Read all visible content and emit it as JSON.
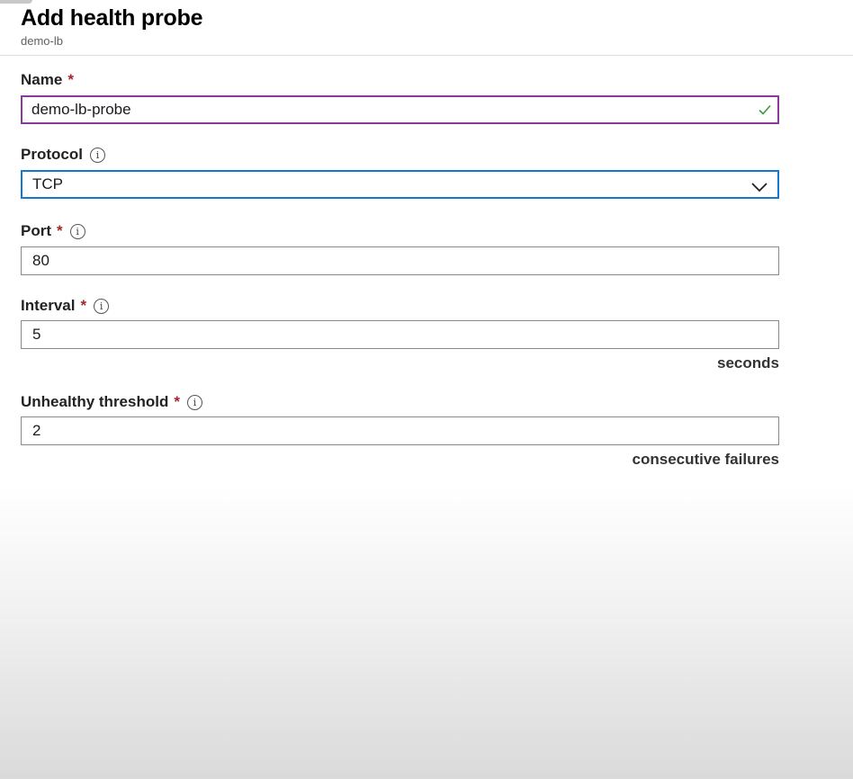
{
  "header": {
    "title": "Add health probe",
    "subtitle": "demo-lb"
  },
  "form": {
    "name": {
      "label": "Name",
      "required_mark": "*",
      "value": "demo-lb-probe",
      "status_icon": "check-icon"
    },
    "protocol": {
      "label": "Protocol",
      "info_mark": "i",
      "value": "TCP",
      "dropdown_icon": "chevron-down-icon"
    },
    "port": {
      "label": "Port",
      "required_mark": "*",
      "info_mark": "i",
      "value": "80"
    },
    "interval": {
      "label": "Interval",
      "required_mark": "*",
      "info_mark": "i",
      "value": "5",
      "unit": "seconds"
    },
    "unhealthy_threshold": {
      "label": "Unhealthy threshold",
      "required_mark": "*",
      "info_mark": "i",
      "value": "2",
      "unit": "consecutive failures"
    }
  },
  "colors": {
    "required": "#a4262c",
    "valid_border": "#8a3a9e",
    "focus_border": "#1677d2",
    "check": "#3a9a3a"
  }
}
